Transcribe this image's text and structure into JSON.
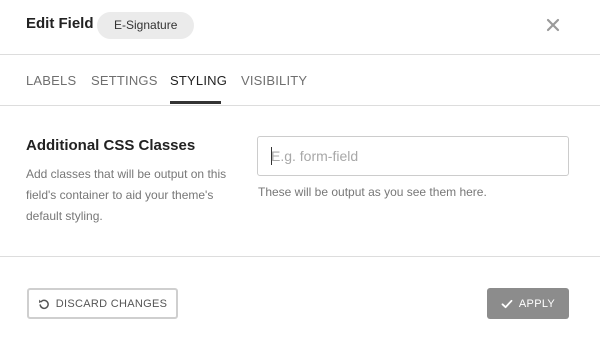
{
  "header": {
    "title": "Edit Field",
    "badge": "E-Signature"
  },
  "tabs": [
    {
      "label": "LABELS",
      "active": false
    },
    {
      "label": "SETTINGS",
      "active": false
    },
    {
      "label": "STYLING",
      "active": true
    },
    {
      "label": "VISIBILITY",
      "active": false
    }
  ],
  "content": {
    "section_title": "Additional CSS Classes",
    "section_desc": "Add classes that will be output on this field's container to aid your theme's default styling.",
    "input_placeholder": "E.g. form-field",
    "input_value": "",
    "help_text": "These will be output as you see them here."
  },
  "footer": {
    "discard_label": "DISCARD CHANGES",
    "apply_label": "APPLY"
  },
  "icons": {
    "close": "close-icon",
    "discard": "undo-icon",
    "apply": "check-icon"
  },
  "colors": {
    "apply_bg": "#8c8c8c",
    "active_tab": "#222222",
    "inactive_tab": "#6f6f6f"
  }
}
